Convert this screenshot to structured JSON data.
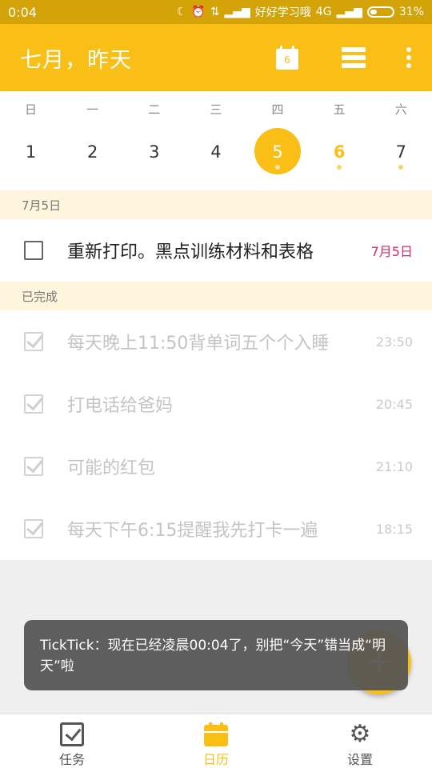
{
  "status_bar": {
    "time": "0:04",
    "carrier": "好好学习哦",
    "network": "4G",
    "battery": "31%",
    "icons": [
      "moon-icon",
      "alarm-icon",
      "data-icon",
      "signal-icon",
      "signal-icon-2",
      "battery-icon"
    ]
  },
  "app_bar": {
    "title": "七月，昨天",
    "calendar_day": "6",
    "icons": [
      "calendar-today-icon",
      "list-view-icon",
      "more-vert-icon"
    ]
  },
  "calendar": {
    "weekdays": [
      "日",
      "一",
      "二",
      "三",
      "四",
      "五",
      "六"
    ],
    "days": [
      {
        "num": "1",
        "state": "normal",
        "dot": false
      },
      {
        "num": "2",
        "state": "normal",
        "dot": false
      },
      {
        "num": "3",
        "state": "normal",
        "dot": false
      },
      {
        "num": "4",
        "state": "normal",
        "dot": false
      },
      {
        "num": "5",
        "state": "selected",
        "dot": true
      },
      {
        "num": "6",
        "state": "today",
        "dot": true
      },
      {
        "num": "7",
        "state": "normal",
        "dot": true
      }
    ]
  },
  "sections": {
    "pending": {
      "header": "7月5日",
      "tasks": [
        {
          "title": "重新打印。黑点训练材料和表格",
          "meta": "7月5日"
        }
      ]
    },
    "completed": {
      "header": "已完成",
      "tasks": [
        {
          "title": "每天晚上11:50背单词五个个入睡",
          "meta": "23:50"
        },
        {
          "title": "打电话给爸妈",
          "meta": "20:45"
        },
        {
          "title": "可能的红包",
          "meta": "21:10"
        },
        {
          "title": "每天下午6:15提醒我先打卡一遍",
          "meta": "18:15"
        }
      ]
    }
  },
  "fab": {
    "label": "+"
  },
  "toast": {
    "text": "TickTick：现在已经凌晨00:04了，别把“今天”错当成“明天”啦"
  },
  "bottom_nav": {
    "items": [
      {
        "label": "任务",
        "icon": "task-check-icon"
      },
      {
        "label": "日历",
        "icon": "calendar-icon"
      },
      {
        "label": "设置",
        "icon": "gear-icon"
      }
    ]
  },
  "colors": {
    "accent": "#f9bf16",
    "status_bar": "#d4a307",
    "due_date": "#d9286a",
    "section_header_bg": "#fef5dc"
  }
}
